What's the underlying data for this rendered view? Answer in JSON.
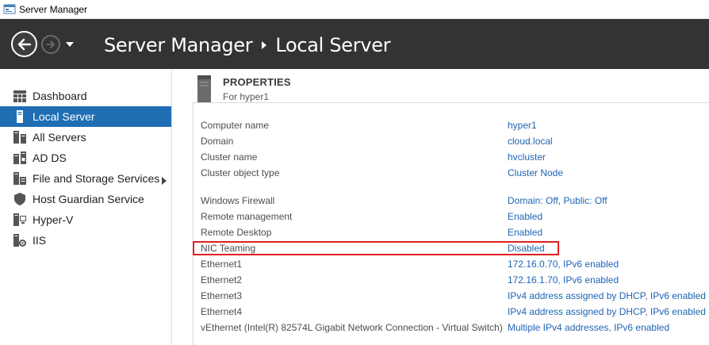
{
  "window": {
    "title": "Server Manager",
    "app_icon": "server-manager-icon"
  },
  "header": {
    "back_icon": "back-arrow-icon",
    "forward_icon": "forward-arrow-icon",
    "dropdown_icon": "chevron-down-icon",
    "breadcrumb": [
      "Server Manager",
      "Local Server"
    ],
    "separator_icon": "triangle-right-icon"
  },
  "sidebar": {
    "items": [
      {
        "label": "Dashboard",
        "icon": "dashboard-icon",
        "selected": false
      },
      {
        "label": "Local Server",
        "icon": "local-server-icon",
        "selected": true
      },
      {
        "label": "All Servers",
        "icon": "all-servers-icon",
        "selected": false
      },
      {
        "label": "AD DS",
        "icon": "ad-ds-icon",
        "selected": false
      },
      {
        "label": "File and Storage Services",
        "icon": "storage-icon",
        "selected": false,
        "has_submenu": true
      },
      {
        "label": "Host Guardian Service",
        "icon": "shield-icon",
        "selected": false
      },
      {
        "label": "Hyper-V",
        "icon": "hyper-v-icon",
        "selected": false
      },
      {
        "label": "IIS",
        "icon": "iis-icon",
        "selected": false
      }
    ]
  },
  "properties": {
    "title": "PROPERTIES",
    "subtitle": "For hyper1",
    "rows": [
      {
        "key": "Computer name",
        "value": "hyper1"
      },
      {
        "key": "Domain",
        "value": "cloud.local"
      },
      {
        "key": "Cluster name",
        "value": "hvcluster"
      },
      {
        "key": "Cluster object type",
        "value": "Cluster Node"
      },
      {
        "key": "Windows Firewall",
        "value": "Domain: Off, Public: Off"
      },
      {
        "key": "Remote management",
        "value": "Enabled"
      },
      {
        "key": "Remote Desktop",
        "value": "Enabled"
      },
      {
        "key": "NIC Teaming",
        "value": "Disabled",
        "highlighted": true
      },
      {
        "key": "Ethernet1",
        "value": "172.16.0.70, IPv6 enabled"
      },
      {
        "key": "Ethernet2",
        "value": "172.16.1.70, IPv6 enabled"
      },
      {
        "key": "Ethernet3",
        "value": "IPv4 address assigned by DHCP, IPv6 enabled"
      },
      {
        "key": "Ethernet4",
        "value": "IPv4 address assigned by DHCP, IPv6 enabled"
      },
      {
        "key": "vEthernet (Intel(R) 82574L Gigabit Network Connection - Virtual Switch)",
        "value": "Multiple IPv4 addresses, IPv6 enabled"
      }
    ]
  },
  "colors": {
    "header_bg": "#333333",
    "selected_bg": "#1f6eb3",
    "link": "#1e64b4",
    "highlight_border": "#e02020"
  }
}
